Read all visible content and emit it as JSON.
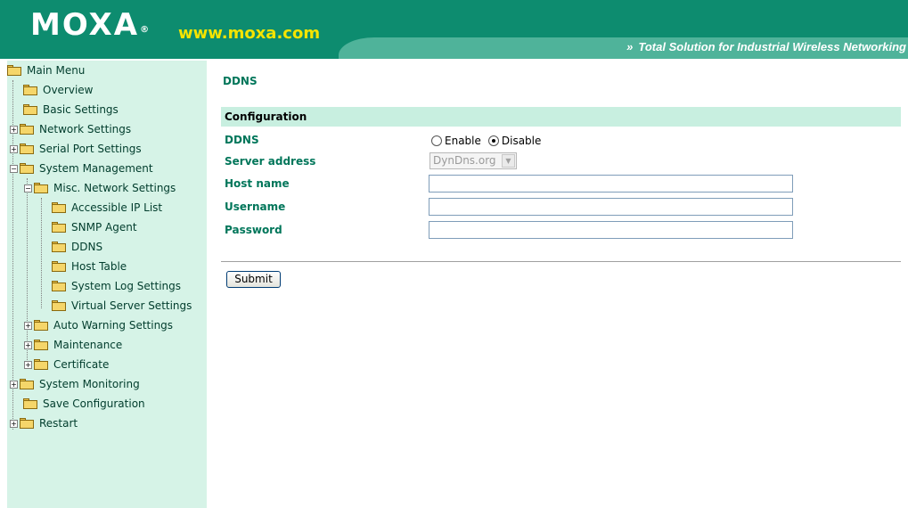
{
  "header": {
    "logo_text": "MOXA",
    "logo_reg": "®",
    "site_url": "www.moxa.com",
    "tagline_icon": "»",
    "tagline": "Total Solution for Industrial Wireless Networking"
  },
  "sidebar": {
    "items": [
      {
        "label": "Main Menu",
        "icon": "open-folder-icon"
      },
      {
        "label": "Overview",
        "icon": "folder-icon"
      },
      {
        "label": "Basic Settings",
        "icon": "folder-icon"
      },
      {
        "label": "Network Settings",
        "icon": "folder-icon",
        "expander": "+"
      },
      {
        "label": "Serial Port Settings",
        "icon": "folder-icon",
        "expander": "+"
      },
      {
        "label": "System Management",
        "icon": "open-folder-icon",
        "expander": "−"
      },
      {
        "label": "Misc. Network Settings",
        "icon": "open-folder-icon",
        "expander": "−"
      },
      {
        "label": "Accessible IP List",
        "icon": "folder-icon"
      },
      {
        "label": "SNMP Agent",
        "icon": "folder-icon"
      },
      {
        "label": "DDNS",
        "icon": "folder-icon"
      },
      {
        "label": "Host Table",
        "icon": "folder-icon"
      },
      {
        "label": "System Log Settings",
        "icon": "folder-icon"
      },
      {
        "label": "Virtual Server Settings",
        "icon": "folder-icon"
      },
      {
        "label": "Auto Warning Settings",
        "icon": "folder-icon",
        "expander": "+"
      },
      {
        "label": "Maintenance",
        "icon": "folder-icon",
        "expander": "+"
      },
      {
        "label": "Certificate",
        "icon": "folder-icon",
        "expander": "+"
      },
      {
        "label": "System Monitoring",
        "icon": "folder-icon",
        "expander": "+"
      },
      {
        "label": "Save Configuration",
        "icon": "folder-icon"
      },
      {
        "label": "Restart",
        "icon": "folder-icon",
        "expander": "+"
      }
    ]
  },
  "main": {
    "title": "DDNS",
    "section_title": "Configuration",
    "fields": {
      "ddns_label": "DDNS",
      "enable_label": "Enable",
      "disable_label": "Disable",
      "selected": "Disable",
      "server_label": "Server address",
      "server_value": "DynDns.org",
      "host_label": "Host name",
      "host_value": "",
      "username_label": "Username",
      "username_value": "",
      "password_label": "Password",
      "password_value": ""
    },
    "submit_label": "Submit"
  },
  "colors": {
    "brand_green": "#0d8c6f",
    "url_yellow": "#f5e400",
    "sidebar_bg": "#d6f3e7",
    "label_green": "#00765a",
    "section_bg": "#c8efe0"
  }
}
